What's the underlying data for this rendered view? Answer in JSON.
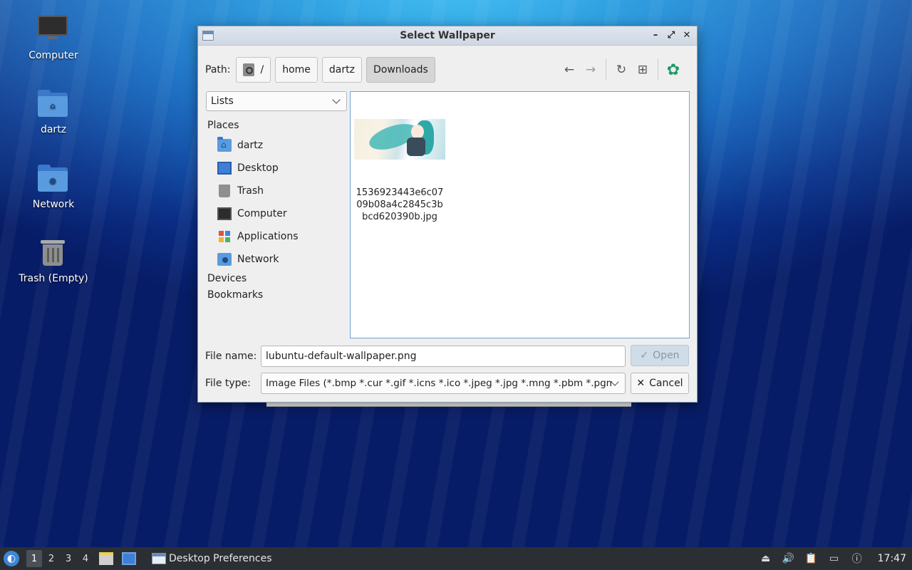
{
  "desktop": {
    "icons": [
      {
        "label": "Computer",
        "icon": "computer-icon"
      },
      {
        "label": "dartz",
        "icon": "home-folder-icon"
      },
      {
        "label": "Network",
        "icon": "network-folder-icon"
      },
      {
        "label": "Trash (Empty)",
        "icon": "trash-icon"
      }
    ]
  },
  "dialog": {
    "title": "Select Wallpaper",
    "path_label": "Path:",
    "breadcrumbs": [
      "/",
      "home",
      "dartz",
      "Downloads"
    ],
    "view_mode": "Lists",
    "sidebar": {
      "places_heading": "Places",
      "places": [
        "dartz",
        "Desktop",
        "Trash",
        "Computer",
        "Applications",
        "Network"
      ],
      "devices_heading": "Devices",
      "bookmarks_heading": "Bookmarks"
    },
    "files": [
      {
        "name": "1536923443e6c0709b08a4c2845c3bbcd620390b.jpg",
        "name_lines": [
          "1536923443e6c07",
          "09b08a4c2845c3b",
          "bcd620390b.jpg"
        ]
      }
    ],
    "filename_label": "File name:",
    "filename_value": "lubuntu-default-wallpaper.png",
    "filetype_label": "File type:",
    "filetype_value": "Image Files (*.bmp *.cur *.gif *.icns *.ico *.jpeg *.jpg *.mng *.pbm *.pgm",
    "open_label": "Open",
    "cancel_label": "Cancel"
  },
  "taskbar": {
    "workspaces": [
      "1",
      "2",
      "3",
      "4"
    ],
    "active_workspace": "1",
    "task_label": "Desktop Preferences",
    "clock": "17:47"
  },
  "colors": {
    "accent": "#3d86d6",
    "taskbar_bg": "#2b2f33",
    "selection_border": "#6fa2d8"
  }
}
